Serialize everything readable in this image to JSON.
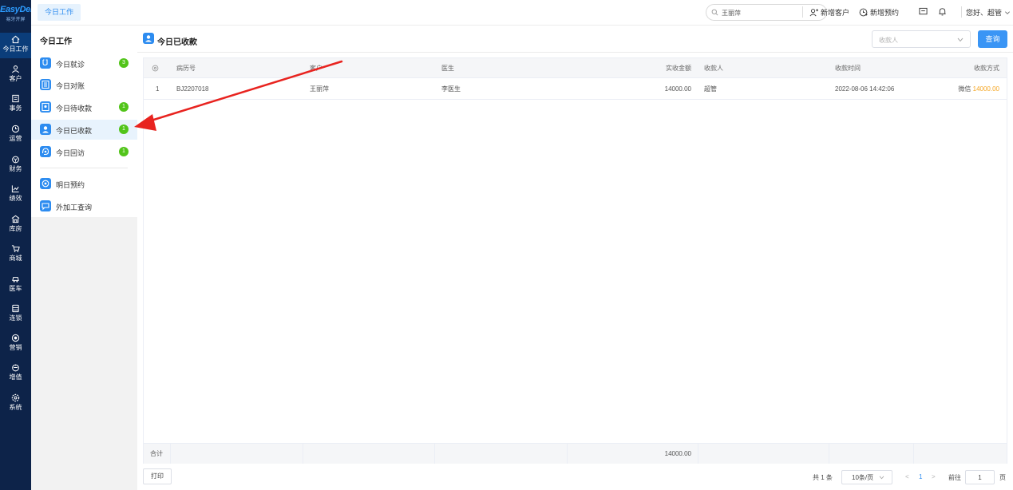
{
  "brand": {
    "name": "EasyDent",
    "subtitle": "易牙开屏"
  },
  "nav": [
    {
      "label": "今日工作",
      "icon": "home-icon"
    },
    {
      "label": "客户",
      "icon": "user-icon"
    },
    {
      "label": "事务",
      "icon": "task-icon"
    },
    {
      "label": "运营",
      "icon": "clock-icon"
    },
    {
      "label": "财务",
      "icon": "finance-icon"
    },
    {
      "label": "绩效",
      "icon": "chart-icon"
    },
    {
      "label": "库房",
      "icon": "warehouse-icon"
    },
    {
      "label": "商城",
      "icon": "cart-icon"
    },
    {
      "label": "医车",
      "icon": "car-icon"
    },
    {
      "label": "连锁",
      "icon": "chain-icon"
    },
    {
      "label": "营销",
      "icon": "marketing-icon"
    },
    {
      "label": "增值",
      "icon": "value-icon"
    },
    {
      "label": "系统",
      "icon": "settings-icon"
    }
  ],
  "topbar": {
    "tab": "今日工作",
    "search_value": "王丽萍",
    "new_customer": "新增客户",
    "new_appointment": "新增预约",
    "greeting": "您好、超管"
  },
  "subpanel": {
    "title": "今日工作",
    "items": [
      {
        "label": "今日就诊",
        "badge": "3",
        "icon": "stethoscope-icon"
      },
      {
        "label": "今日对账",
        "badge": "",
        "icon": "list-icon"
      },
      {
        "label": "今日待收款",
        "badge": "1",
        "icon": "pending-payment-icon"
      },
      {
        "label": "今日已收款",
        "badge": "1",
        "icon": "received-payment-icon"
      },
      {
        "label": "今日回访",
        "badge": "1",
        "icon": "revisit-icon"
      },
      {
        "label": "明日预约",
        "badge": "",
        "icon": "appointment-icon"
      },
      {
        "label": "外加工查询",
        "badge": "",
        "icon": "outsource-icon"
      }
    ]
  },
  "main": {
    "title": "今日已收款",
    "filter_placeholder": "收款人",
    "query_label": "查询",
    "columns": {
      "record_no": "病历号",
      "customer": "客户",
      "doctor": "医生",
      "amount": "实收金额",
      "receiver": "收款人",
      "time": "收款时间",
      "method": "收款方式"
    },
    "rows": [
      {
        "index": "1",
        "record_no": "BJ2207018",
        "customer": "王丽萍",
        "doctor": "李医生",
        "amount": "14000.00",
        "receiver": "超管",
        "time": "2022-08-06 14:42:06",
        "method_name": "微信",
        "method_amount": "14000.00"
      }
    ],
    "footer": {
      "label": "合计",
      "amount": "14000.00"
    },
    "print_label": "打印",
    "pagination": {
      "total": "共 1 条",
      "page_size": "10条/页",
      "prev": "<",
      "current": "1",
      "next": ">",
      "goto_label": "前往",
      "goto_value": "1",
      "page_unit": "页"
    }
  },
  "colors": {
    "accent": "#2d8cf0",
    "nav_bg": "#0d2349",
    "badge": "#52c41a",
    "amount_highlight": "#f5a623",
    "arrow": "#e8231f"
  }
}
